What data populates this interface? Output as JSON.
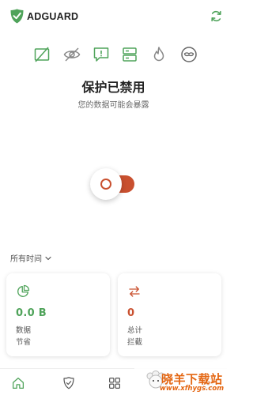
{
  "header": {
    "brand": "ADGUARD",
    "refresh_icon": "refresh-icon",
    "logo_icon": "adguard-shield-logo",
    "brand_color": "#4fa35a"
  },
  "feature_icons": [
    {
      "name": "ad-blocking-icon"
    },
    {
      "name": "tracking-protection-icon"
    },
    {
      "name": "annoyance-blocking-icon"
    },
    {
      "name": "dns-protection-icon"
    },
    {
      "name": "firewall-icon"
    },
    {
      "name": "browsing-security-icon"
    }
  ],
  "status": {
    "title": "保护已禁用",
    "subtitle": "您的数据可能会暴露",
    "toggle_on": false,
    "toggle_color": "#c9502f"
  },
  "period": {
    "label": "所有时间"
  },
  "stats": [
    {
      "value": "0.0 B",
      "label_line1": "数据",
      "label_line2": "节省",
      "icon": "pie-chart-icon",
      "color": "#4fa35a"
    },
    {
      "value": "0",
      "label_line1": "总计",
      "label_line2": "拦截",
      "icon": "swap-arrows-icon",
      "color": "#c9502f"
    }
  ],
  "nav": [
    {
      "name": "home-icon"
    },
    {
      "name": "protection-icon"
    },
    {
      "name": "apps-icon"
    },
    {
      "name": "activity-icon"
    },
    {
      "name": "settings-icon"
    }
  ],
  "watermark": {
    "title": "晓羊下载站",
    "url": "www.xfhygs.com"
  }
}
